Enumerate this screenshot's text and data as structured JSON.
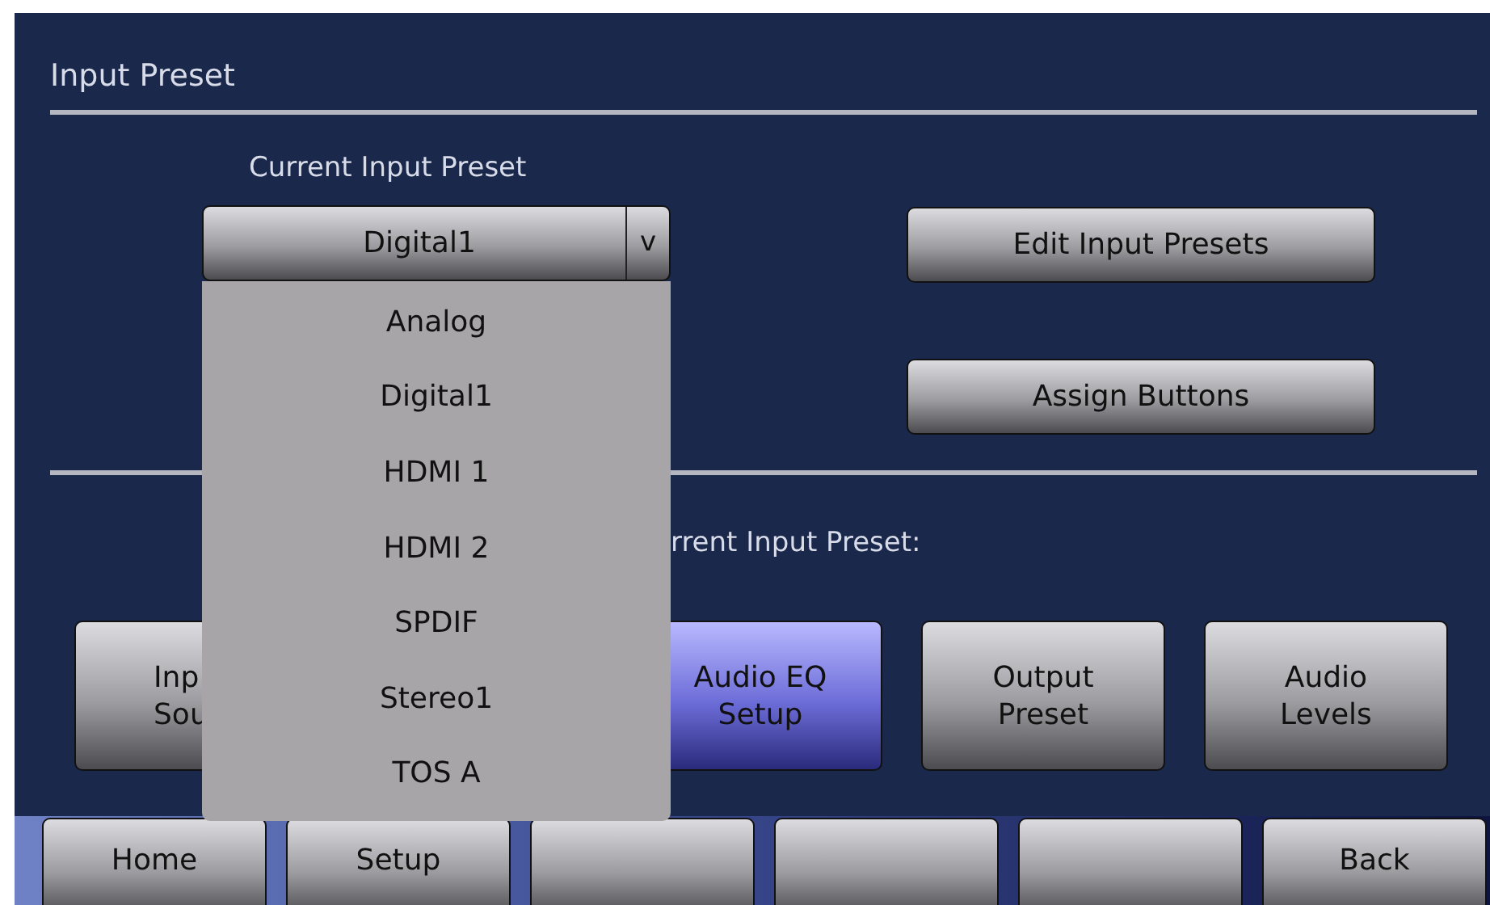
{
  "screen": {
    "title": "Input Preset"
  },
  "current_preset": {
    "label": "Current Input Preset",
    "value": "Digital1",
    "caret": "v",
    "expanded": true,
    "options": [
      "Analog",
      "Digital1",
      "HDMI 1",
      "HDMI 2",
      "SPDIF",
      "Stereo1",
      "TOS A"
    ]
  },
  "actions": [
    "Edit Input Presets",
    "Assign Buttons"
  ],
  "section_label": "rrent Input Preset:",
  "feature_buttons": [
    {
      "lines": [
        "Inp",
        "Sou"
      ],
      "selected": false
    },
    {
      "lines": [
        "Audio EQ",
        "Setup"
      ],
      "selected": true
    },
    {
      "lines": [
        "Output",
        "Preset"
      ],
      "selected": false
    },
    {
      "lines": [
        "Audio",
        "Levels"
      ],
      "selected": false
    }
  ],
  "nav_buttons": [
    {
      "kind": "labeled",
      "label": "Home"
    },
    {
      "kind": "labeled",
      "label": "Setup"
    },
    {
      "kind": "blank"
    },
    {
      "kind": "blank"
    },
    {
      "kind": "blank"
    },
    {
      "kind": "labeled",
      "label": "Back"
    }
  ]
}
